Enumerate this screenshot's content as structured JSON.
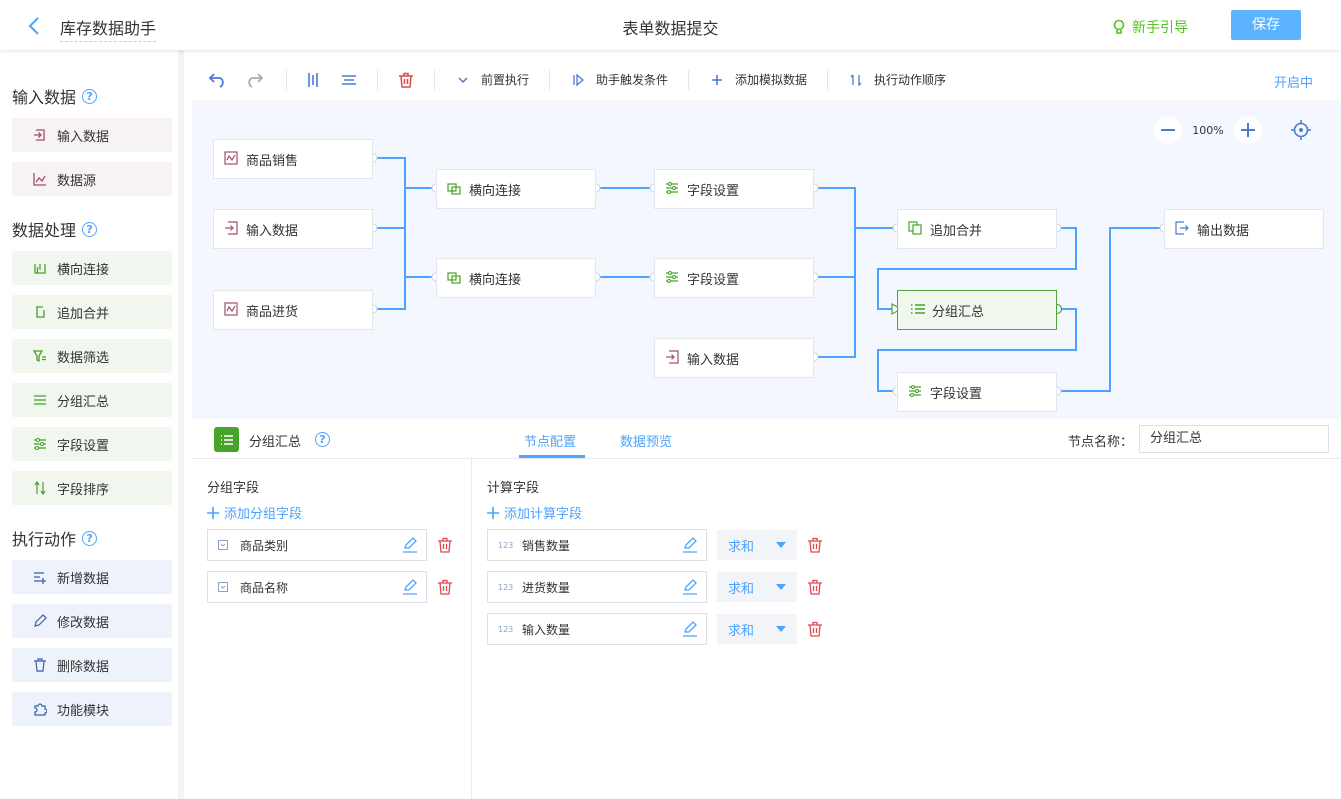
{
  "header": {
    "app_name": "库存数据助手",
    "page_title": "表单数据提交",
    "guide_label": "新手引导",
    "save_label": "保存"
  },
  "sidebar": {
    "sections": [
      {
        "title": "输入数据",
        "items": [
          {
            "label": "输入数据",
            "icon": "input-icon"
          },
          {
            "label": "数据源",
            "icon": "chart-icon"
          }
        ]
      },
      {
        "title": "数据处理",
        "items": [
          {
            "label": "横向连接",
            "icon": "join-icon"
          },
          {
            "label": "追加合并",
            "icon": "append-icon"
          },
          {
            "label": "数据筛选",
            "icon": "filter-icon"
          },
          {
            "label": "分组汇总",
            "icon": "list-icon"
          },
          {
            "label": "字段设置",
            "icon": "sliders-icon"
          },
          {
            "label": "字段排序",
            "icon": "sort-icon"
          }
        ]
      },
      {
        "title": "执行动作",
        "items": [
          {
            "label": "新增数据",
            "icon": "add-row-icon"
          },
          {
            "label": "修改数据",
            "icon": "edit-icon"
          },
          {
            "label": "删除数据",
            "icon": "trash-icon"
          },
          {
            "label": "功能模块",
            "icon": "puzzle-icon"
          }
        ]
      }
    ]
  },
  "toolbar": {
    "pre_exec": "前置执行",
    "trigger": "助手触发条件",
    "add_mock": "添加模拟数据",
    "exec_order": "执行动作顺序",
    "status": "开启中"
  },
  "canvas": {
    "zoom": "100%",
    "nodes": {
      "sales": "商品销售",
      "input1": "输入数据",
      "purchase": "商品进货",
      "join1": "横向连接",
      "join2": "横向连接",
      "field1": "字段设置",
      "field2": "字段设置",
      "input2": "输入数据",
      "append": "追加合并",
      "group": "分组汇总",
      "field3": "字段设置",
      "output": "输出数据"
    }
  },
  "panel": {
    "node_title": "分组汇总",
    "tab_config": "节点配置",
    "tab_preview": "数据预览",
    "name_label": "节点名称：",
    "name_value": "分组汇总",
    "group_title": "分组字段",
    "group_add": "添加分组字段",
    "group_fields": [
      "商品类别",
      "商品名称"
    ],
    "calc_title": "计算字段",
    "calc_add": "添加计算字段",
    "calc_fields": [
      {
        "name": "销售数量",
        "agg": "求和"
      },
      {
        "name": "进货数量",
        "agg": "求和"
      },
      {
        "name": "输入数量",
        "agg": "求和"
      }
    ],
    "num_icon_text": "123"
  }
}
